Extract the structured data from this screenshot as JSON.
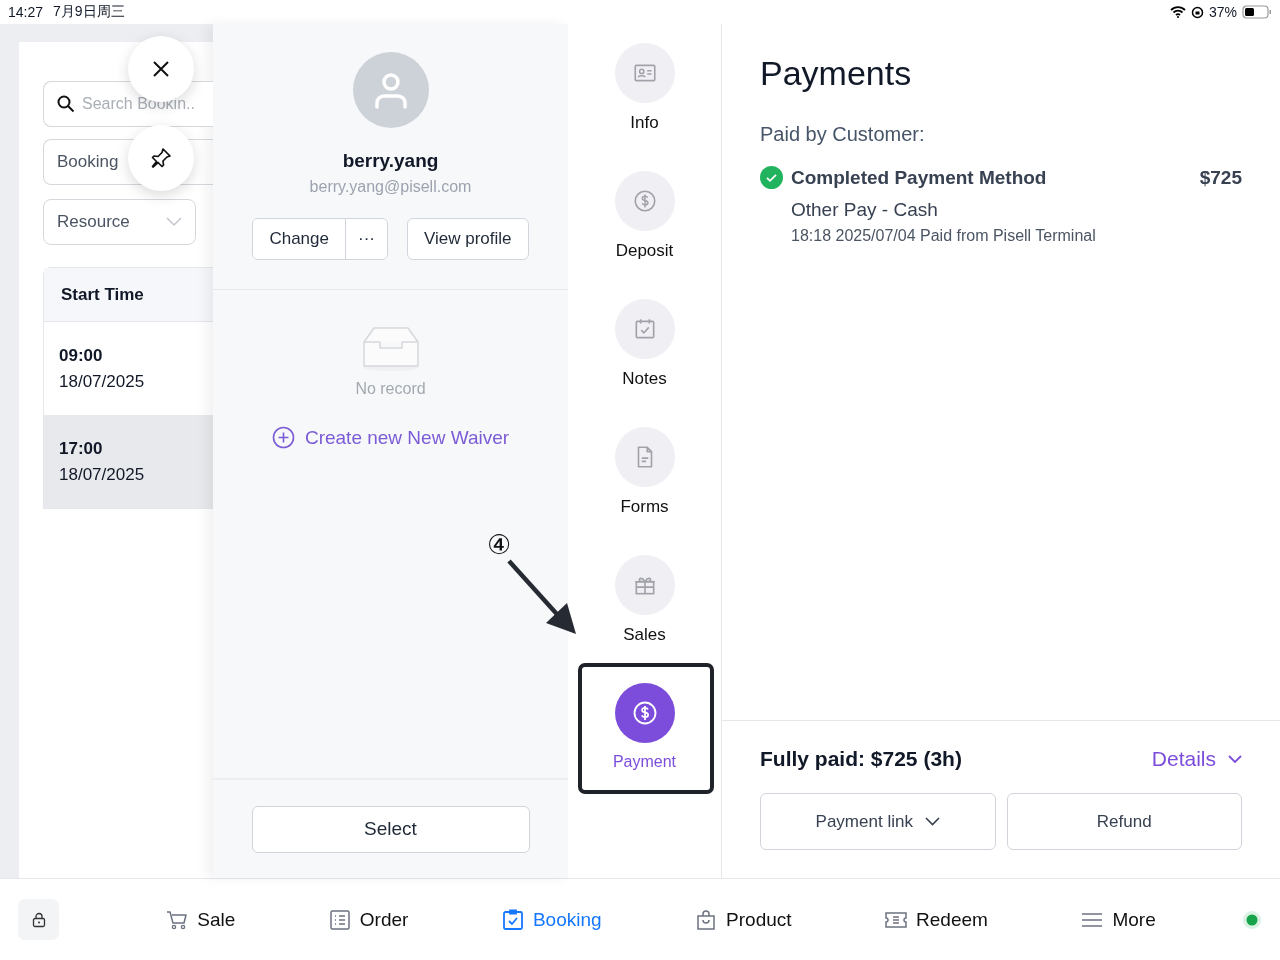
{
  "status_bar": {
    "time": "14:27",
    "date": "7月9日周三",
    "battery": "37%"
  },
  "bookings_panel": {
    "search": {
      "placeholder": "Search Bookin.."
    },
    "filters": [
      {
        "label": "Booking",
        "kind": "text"
      },
      {
        "label": "Resource",
        "kind": "select"
      }
    ],
    "table": {
      "columns": [
        "Start Time"
      ],
      "rows": [
        {
          "time": "09:00",
          "date": "18/07/2025",
          "selected": false
        },
        {
          "time": "17:00",
          "date": "18/07/2025",
          "selected": true
        }
      ]
    }
  },
  "customer": {
    "name": "berry.yang",
    "email": "berry.yang@pisell.com",
    "buttons": {
      "change": "Change",
      "more": "···",
      "view_profile": "View profile"
    }
  },
  "waivers": {
    "empty": "No record",
    "create_link": "Create new New Waiver"
  },
  "select_button": "Select",
  "side_nav": [
    {
      "label": "Info",
      "selected": false
    },
    {
      "label": "Deposit",
      "selected": false
    },
    {
      "label": "Notes",
      "selected": false
    },
    {
      "label": "Forms",
      "selected": false
    },
    {
      "label": "Sales",
      "selected": false
    },
    {
      "label": "Payment",
      "selected": true
    }
  ],
  "annotation": {
    "marker": "④"
  },
  "payments": {
    "title": "Payments",
    "paid_by": "Paid by Customer:",
    "entries": [
      {
        "title": "Completed Payment Method",
        "amount": "$725",
        "method": "Other Pay - Cash",
        "detail": "18:18 2025/07/04 Paid from Pisell Terminal"
      }
    ],
    "summary": "Fully paid: $725 (3h)",
    "details": "Details",
    "buttons": {
      "payment_link": "Payment link",
      "refund": "Refund"
    }
  },
  "bottom_nav": [
    {
      "label": "Sale",
      "selected": false
    },
    {
      "label": "Order",
      "selected": false
    },
    {
      "label": "Booking",
      "selected": true
    },
    {
      "label": "Product",
      "selected": false
    },
    {
      "label": "Redeem",
      "selected": false
    },
    {
      "label": "More",
      "selected": false
    }
  ]
}
